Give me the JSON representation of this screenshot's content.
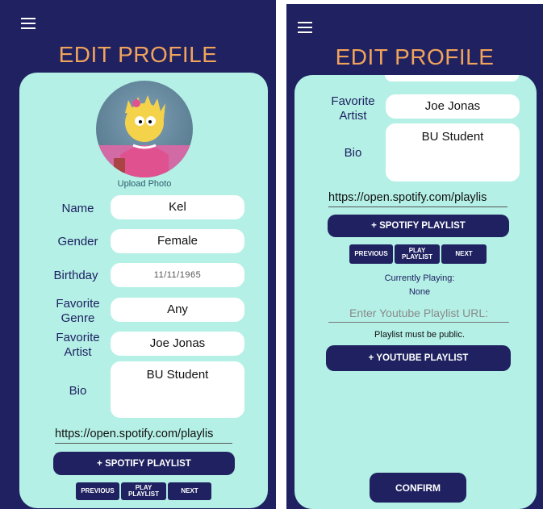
{
  "title": "EDIT PROFILE",
  "upload_photo": "Upload Photo",
  "labels": {
    "name": "Name",
    "gender": "Gender",
    "birthday": "Birthday",
    "genre_line1": "Favorite",
    "genre_line2": "Genre",
    "artist_line1": "Favorite",
    "artist_line2": "Artist",
    "bio": "Bio"
  },
  "values": {
    "name": "Kel",
    "gender": "Female",
    "birthday": "11/11/1965",
    "genre": "Any",
    "artist": "Joe Jonas",
    "bio": "BU Student"
  },
  "spotify_url": "https://open.spotify.com/playlis",
  "spotify_button": "+ SPOTIFY PLAYLIST",
  "player": {
    "previous": "PREVIOUS",
    "play_line1": "PLAY",
    "play_line2": "PLAYLIST",
    "next": "NEXT"
  },
  "currently_playing_label": "Currently Playing:",
  "currently_playing_value": "None",
  "youtube_placeholder": "Enter Youtube Playlist URL:",
  "youtube_note": "Playlist must be public.",
  "youtube_button": "+ YOUTUBE PLAYLIST",
  "confirm_button": "CONFIRM",
  "colors": {
    "navy": "#1f2161",
    "card": "#b4f0e6",
    "title": "#f0a35b"
  },
  "icons": [
    "menu-icon"
  ]
}
